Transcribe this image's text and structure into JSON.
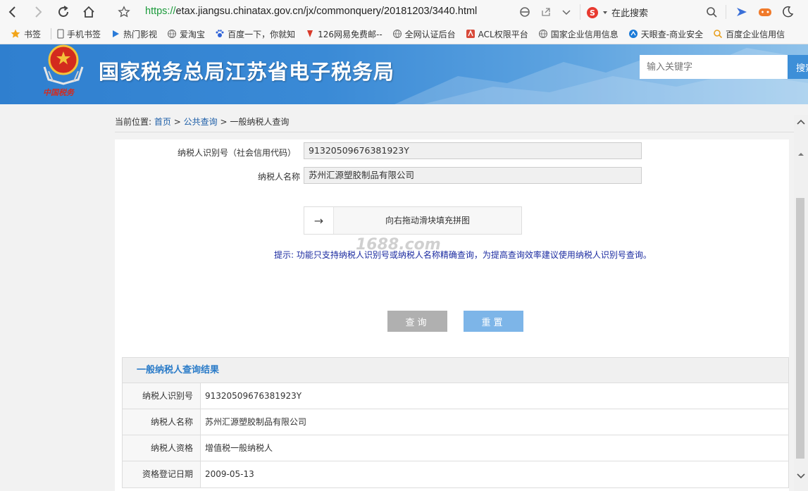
{
  "browser": {
    "url_protocol": "https://",
    "url_rest": "etax.jiangsu.chinatax.gov.cn/jx/commonquery/20181203/3440.html",
    "search_placeholder": "在此搜索"
  },
  "bookmarks": [
    {
      "label": "书签",
      "icon": "star-icon"
    },
    {
      "label": "手机书签",
      "icon": "phone-icon"
    },
    {
      "label": "热门影视",
      "icon": "play-icon"
    },
    {
      "label": "爱淘宝",
      "icon": "globe-icon"
    },
    {
      "label": "百度一下，你就知",
      "icon": "paw-icon"
    },
    {
      "label": "126网易免费邮--",
      "icon": "mail-icon"
    },
    {
      "label": "全网认证后台",
      "icon": "globe-icon"
    },
    {
      "label": "ACL权限平台",
      "icon": "acl-icon"
    },
    {
      "label": "国家企业信用信息",
      "icon": "globe-icon"
    },
    {
      "label": "天眼查-商业安全",
      "icon": "eye-icon"
    },
    {
      "label": "百度企业信用信",
      "icon": "search-icon"
    }
  ],
  "header": {
    "title": "国家税务总局江苏省电子税务局",
    "search_placeholder": "输入关键字",
    "search_button": "搜索",
    "logo_caption": "中国税务"
  },
  "breadcrumb": {
    "prefix": "当前位置:",
    "home": "首页",
    "sep": ">",
    "section": "公共查询",
    "current": "一般纳税人查询"
  },
  "form": {
    "id_label": "纳税人识别号（社会信用代码）",
    "id_value": "91320509676381923Y",
    "name_label": "纳税人名称",
    "name_value": "苏州汇源塑胶制品有限公司",
    "slider_text": "向右拖动滑块填充拼图",
    "slider_arrow": "→",
    "hint": "提示:  功能只支持纳税人识别号或纳税人名称精确查询，为提高查询效率建议使用纳税人识别号查询。",
    "watermark": "1688.com",
    "query_button": "查询",
    "reset_button": "重置"
  },
  "result": {
    "title": "一般纳税人查询结果",
    "rows": [
      {
        "label": "纳税人识别号",
        "value": "91320509676381923Y"
      },
      {
        "label": "纳税人名称",
        "value": "苏州汇源塑胶制品有限公司"
      },
      {
        "label": "纳税人资格",
        "value": "增值税一般纳税人"
      },
      {
        "label": "资格登记日期",
        "value": "2009-05-13"
      }
    ]
  },
  "colors": {
    "accent": "#2a7bc8",
    "banner": "#3a8ad6",
    "reset_button": "#7db5e8",
    "query_button": "#b0b0b0",
    "hint_text": "#1a2aa0"
  }
}
